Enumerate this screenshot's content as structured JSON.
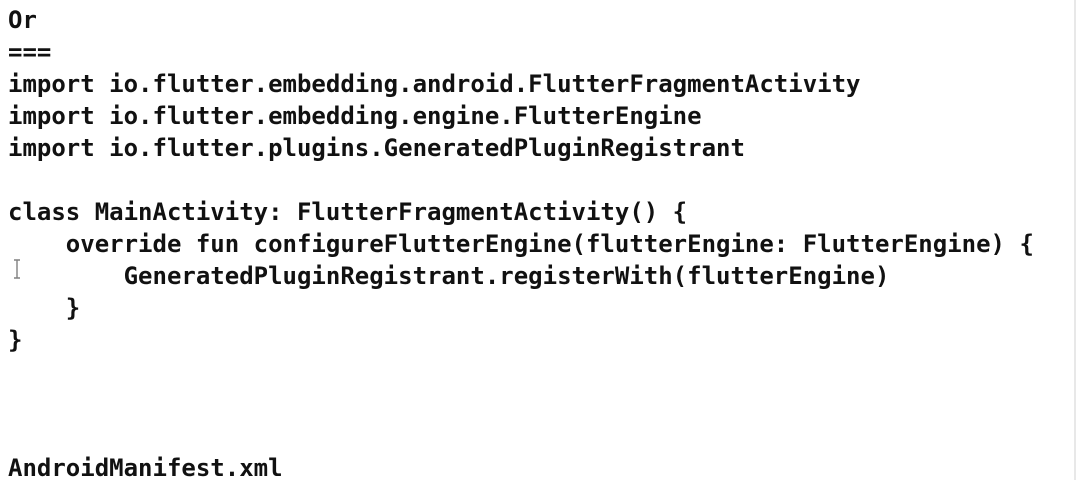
{
  "document": {
    "lines": [
      "Or",
      "===",
      "import io.flutter.embedding.android.FlutterFragmentActivity",
      "import io.flutter.embedding.engine.FlutterEngine",
      "import io.flutter.plugins.GeneratedPluginRegistrant",
      "",
      "class MainActivity: FlutterFragmentActivity() {",
      "    override fun configureFlutterEngine(flutterEngine: FlutterEngine) {",
      "        GeneratedPluginRegistrant.registerWith(flutterEngine)",
      "    }",
      "}",
      "",
      "",
      "",
      "AndroidManifest.xml"
    ]
  },
  "cursor_icon": "text-cursor-icon"
}
